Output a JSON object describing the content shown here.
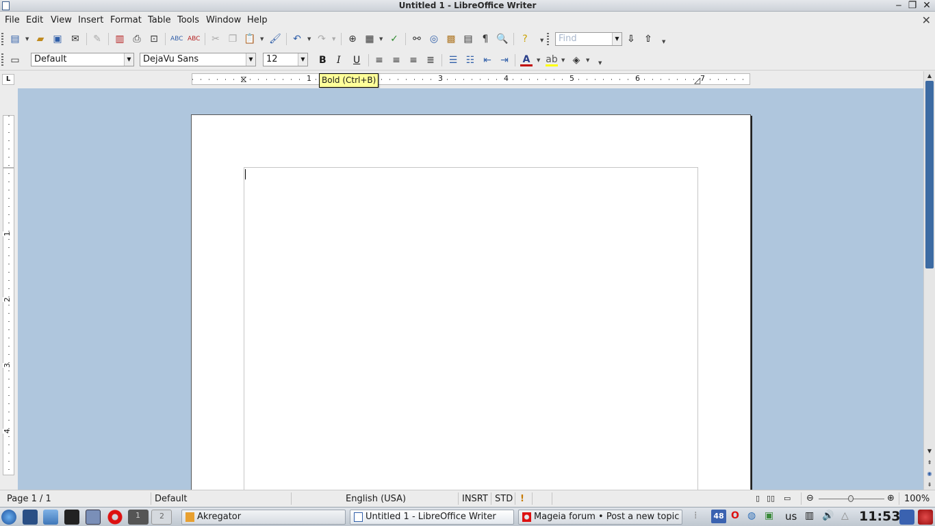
{
  "window": {
    "title": "Untitled 1 - LibreOffice Writer",
    "minimize": "‒",
    "maximize": "❐",
    "close": "✕",
    "doc_close": "✕"
  },
  "menu": [
    "File",
    "Edit",
    "View",
    "Insert",
    "Format",
    "Table",
    "Tools",
    "Window",
    "Help"
  ],
  "toolbar1": {
    "icons": [
      "new-document-icon",
      "open-icon",
      "save-icon",
      "email-icon",
      "edit-file-icon",
      "export-pdf-icon",
      "print-icon",
      "print-preview-icon",
      "spellcheck-icon",
      "autospellcheck-icon",
      "cut-icon",
      "copy-icon",
      "paste-icon",
      "clone-formatting-icon",
      "undo-icon",
      "redo-icon",
      "hyperlink-icon",
      "table-icon",
      "show-draw-functions-icon",
      "find-replace-icon",
      "navigator-icon",
      "gallery-icon",
      "data-sources-icon",
      "formatting-marks-icon",
      "zoom-icon",
      "help-icon"
    ],
    "find_placeholder": "Find"
  },
  "toolbar2": {
    "paragraph_style": "Default",
    "font_name": "DejaVu Sans",
    "font_size": "12",
    "bold": "B",
    "italic": "I",
    "underline": "U"
  },
  "tooltip": "Bold (Ctrl+B)",
  "ruler": {
    "corner": "L",
    "h_numbers": [
      "1",
      "3",
      "4",
      "5",
      "6",
      "7"
    ],
    "v_numbers": [
      "1",
      "2",
      "3",
      "4"
    ]
  },
  "statusbar": {
    "page": "Page 1 / 1",
    "style": "Default",
    "language": "English (USA)",
    "insert_mode": "INSRT",
    "selection_mode": "STD",
    "zoom": "100%",
    "zoom_level": 100
  },
  "taskbar": {
    "tasks": [
      {
        "label": "Akregator",
        "icon": "akregator-icon",
        "active": false
      },
      {
        "label": "Untitled 1 - LibreOffice Writer",
        "icon": "writer-icon",
        "active": true
      },
      {
        "label": "Mageia forum • Post a new topic -",
        "icon": "opera-icon",
        "active": false
      }
    ],
    "desktop_pager": [
      "1",
      "2"
    ],
    "mail_count": "48",
    "keyboard_layout": "us",
    "clock": "11:53"
  },
  "colors": {
    "accent": "#3d6ba3",
    "doc_background": "#afc6dd",
    "tooltip_bg": "#ffff99",
    "font_color_red": "#c00000",
    "highlight_yellow": "#ffff00"
  }
}
